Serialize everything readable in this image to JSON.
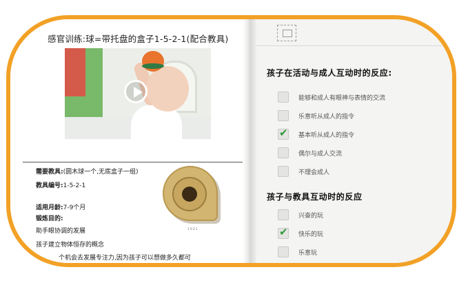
{
  "lesson": {
    "title": "感官训练:球=带托盘的盒子1-5-2-1(配合教具)"
  },
  "info": {
    "materials_label": "需要教具:",
    "materials_value": "(圆木球一个,无底盒子一组)",
    "code_label": "教具编号:",
    "code_value": "1-5-2-1",
    "age_label": "适用月龄:",
    "age_value": "7-9个月",
    "goal_label": "锻炼目的:",
    "goal_1": "助手眼协调的发展",
    "goal_2": "孩子建立物体恒存的概念",
    "goal_3": "个机会去发展专注力,因为孩子可以想做多久都可"
  },
  "figure": {
    "caption": "1-5-2-1"
  },
  "right": {
    "section1_title": "孩子在活动与成人互动时的反应:",
    "section1_options": [
      {
        "label": "能够和成人有眼神与表情的交流",
        "checked": false
      },
      {
        "label": "乐意听从成人的指令",
        "checked": false
      },
      {
        "label": "基本听从成人的指令",
        "checked": true
      },
      {
        "label": "偶尔与成人交流",
        "checked": false
      },
      {
        "label": "不理会成人",
        "checked": false
      }
    ],
    "section2_title": "孩子与教具互动时的反应",
    "section2_options": [
      {
        "label": "兴奋的玩",
        "checked": false
      },
      {
        "label": "快乐的玩",
        "checked": true
      },
      {
        "label": "乐意玩",
        "checked": false
      }
    ]
  },
  "icons": {
    "play": "play-icon",
    "check": "checkmark-icon",
    "tile": "image-tile-icon"
  },
  "colors": {
    "frame": "#f2a126",
    "check": "#2f9a3a"
  }
}
